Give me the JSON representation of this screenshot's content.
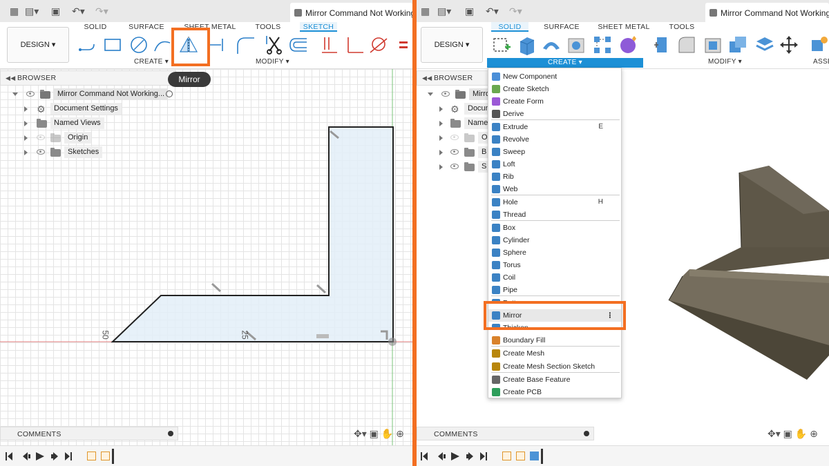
{
  "left": {
    "doc_title": "Mirror Command Not Working",
    "design_label": "DESIGN ▾",
    "tabs": [
      "SOLID",
      "SURFACE",
      "SHEET METAL",
      "TOOLS",
      "SKETCH"
    ],
    "active_tab": "SKETCH",
    "groups": {
      "create": "CREATE ▾",
      "modify": "MODIFY ▾"
    },
    "tooltip": "Mirror",
    "browser": {
      "title": "BROWSER",
      "root": "Mirror Command Not Working...",
      "items": [
        "Document Settings",
        "Named Views",
        "Origin",
        "Sketches"
      ]
    },
    "dimensions": {
      "d1": "50",
      "d2": "25"
    },
    "comments": "COMMENTS"
  },
  "right": {
    "doc_title": "Mirror Command Not Working",
    "design_label": "DESIGN ▾",
    "tabs": [
      "SOLID",
      "SURFACE",
      "SHEET METAL",
      "TOOLS"
    ],
    "active_tab": "SOLID",
    "groups": {
      "create": "CREATE ▾",
      "modify": "MODIFY ▾",
      "assemble": "ASSE"
    },
    "browser": {
      "title": "BROWSER",
      "root": "Mirro",
      "items": [
        "Docun",
        "Name",
        "O",
        "B",
        "S"
      ]
    },
    "comments": "COMMENTS",
    "create_menu": {
      "items": [
        {
          "label": "New Component",
          "icon": "new-component-icon",
          "color": "#4a8fd8"
        },
        {
          "label": "Create Sketch",
          "icon": "create-sketch-icon",
          "color": "#6aa84f"
        },
        {
          "label": "Create Form",
          "icon": "create-form-icon",
          "color": "#9b59d6"
        },
        {
          "label": "Derive",
          "icon": "derive-icon",
          "color": "#555555"
        },
        {
          "label": "Extrude",
          "icon": "extrude-icon",
          "color": "#3b82c4",
          "shortcut": "E"
        },
        {
          "label": "Revolve",
          "icon": "revolve-icon",
          "color": "#3b82c4"
        },
        {
          "label": "Sweep",
          "icon": "sweep-icon",
          "color": "#3b82c4"
        },
        {
          "label": "Loft",
          "icon": "loft-icon",
          "color": "#3b82c4"
        },
        {
          "label": "Rib",
          "icon": "rib-icon",
          "color": "#3b82c4"
        },
        {
          "label": "Web",
          "icon": "web-icon",
          "color": "#3b82c4"
        },
        {
          "label": "Hole",
          "icon": "hole-icon",
          "color": "#3b82c4",
          "shortcut": "H"
        },
        {
          "label": "Thread",
          "icon": "thread-icon",
          "color": "#3b82c4"
        },
        {
          "label": "Box",
          "icon": "box-icon",
          "color": "#3b82c4"
        },
        {
          "label": "Cylinder",
          "icon": "cylinder-icon",
          "color": "#3b82c4"
        },
        {
          "label": "Sphere",
          "icon": "sphere-icon",
          "color": "#3b82c4"
        },
        {
          "label": "Torus",
          "icon": "torus-icon",
          "color": "#3b82c4"
        },
        {
          "label": "Coil",
          "icon": "coil-icon",
          "color": "#3b82c4"
        },
        {
          "label": "Pipe",
          "icon": "pipe-icon",
          "color": "#3b82c4"
        },
        {
          "label": "Pattern",
          "icon": "pattern-icon",
          "color": "#3b82c4"
        },
        {
          "label": "Mirror",
          "icon": "mirror-icon",
          "color": "#3b82c4"
        },
        {
          "label": "Thicken",
          "icon": "thicken-icon",
          "color": "#3b82c4"
        },
        {
          "label": "Boundary Fill",
          "icon": "boundary-fill-icon",
          "color": "#d9822b"
        },
        {
          "label": "Create Mesh",
          "icon": "create-mesh-icon",
          "color": "#b8860b"
        },
        {
          "label": "Create Mesh Section Sketch",
          "icon": "mesh-section-icon",
          "color": "#b8860b"
        },
        {
          "label": "Create Base Feature",
          "icon": "base-feature-icon",
          "color": "#666666"
        },
        {
          "label": "Create PCB",
          "icon": "pcb-icon",
          "color": "#2e9e5b"
        }
      ]
    }
  },
  "colors": {
    "highlight": "#f36f22",
    "accent": "#1d90d6",
    "solid_body": "#5e5748"
  }
}
